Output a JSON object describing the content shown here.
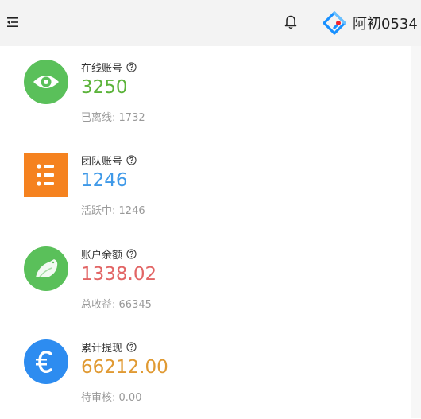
{
  "header": {
    "user_name": "阿初0534",
    "icons": [
      "menu-fold-icon",
      "bell-icon",
      "logo-icon"
    ]
  },
  "cards": [
    {
      "title": "在线账号",
      "value": "3250",
      "sub_label": "已离线:",
      "sub_value": "1732",
      "icon": "eye-icon",
      "icon_color": "#5ac05a",
      "value_color": "#5bb33a"
    },
    {
      "title": "团队账号",
      "value": "1246",
      "sub_label": "活跃中:",
      "sub_value": "1246",
      "icon": "list-icon",
      "icon_color": "#f5821f",
      "value_color": "#3f99e8"
    },
    {
      "title": "账户余额",
      "value": "1338.02",
      "sub_label": "总收益:",
      "sub_value": "66345",
      "icon": "bird-icon",
      "icon_color": "#5ac05a",
      "value_color": "#e26565"
    },
    {
      "title": "累计提现",
      "value": "66212.00",
      "sub_label": "待审核:",
      "sub_value": "0.00",
      "icon": "euro-icon",
      "icon_color": "#2d8cf0",
      "value_color": "#e09a33"
    }
  ]
}
